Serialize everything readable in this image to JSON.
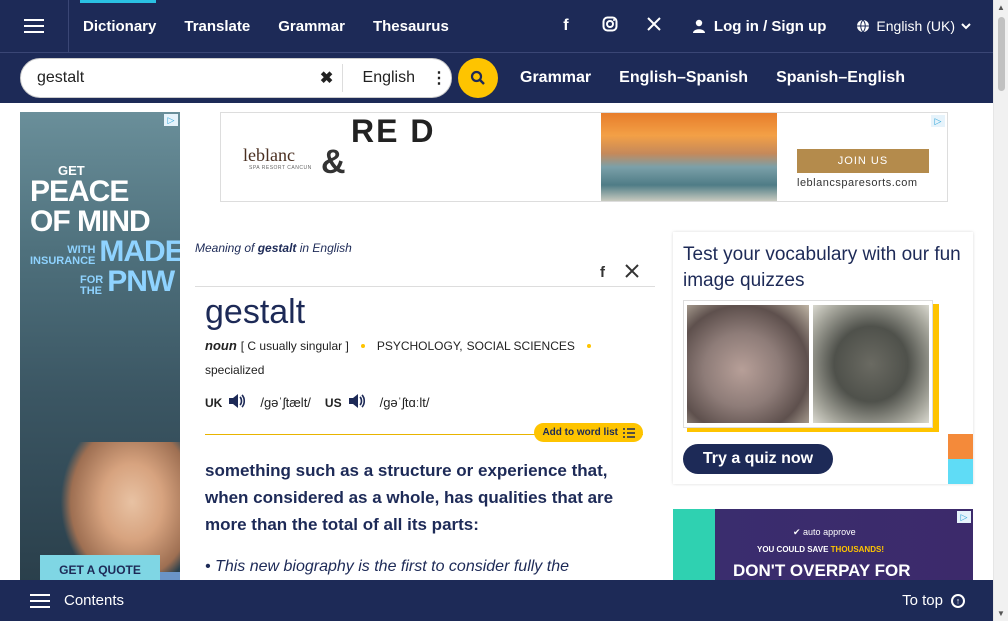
{
  "nav": {
    "links": [
      "Dictionary",
      "Translate",
      "Grammar",
      "Thesaurus"
    ],
    "login": "Log in / Sign up",
    "language": "English (UK)"
  },
  "search": {
    "value": "gestalt",
    "dictionary": "English"
  },
  "subnav": {
    "links": [
      "Grammar",
      "English–Spanish",
      "Spanish–English"
    ]
  },
  "left_ad": {
    "line1": "GET",
    "line2": "PEACE",
    "line3": "OF MIND",
    "line4": "WITH",
    "line5": "MADE",
    "line6": "INSURANCE",
    "line7": "FOR",
    "line8": "THE",
    "line9": "PNW",
    "cta": "GET A QUOTE"
  },
  "top_ad": {
    "brand": "leblanc",
    "brand_sub": "SPA RESORT CANCUN",
    "amp": "&",
    "red": "RE D",
    "join": "JOIN US",
    "url": "leblancsparesorts.com"
  },
  "entry": {
    "meaning_prefix": "Meaning of",
    "meaning_word": "gestalt",
    "meaning_suffix": "in English",
    "headword": "gestalt",
    "pos": "noun",
    "grammar": "[ C usually singular ]",
    "domains": [
      "PSYCHOLOGY,",
      "SOCIAL SCIENCES"
    ],
    "register": "specialized",
    "uk_label": "UK",
    "uk_ipa": "/ɡəˈʃtælt/",
    "us_label": "US",
    "us_ipa": "/ɡəˈʃtɑːlt/",
    "word_list": "Add to word list",
    "definition": "something such as a structure or experience that, when considered as a whole, has qualities that are more than the total of all its parts:",
    "example": "• This new biography is the first to consider fully the"
  },
  "quiz": {
    "title": "Test your vocabulary with our fun image quizzes",
    "button": "Try a quiz now"
  },
  "right_ad": {
    "brand": "auto approve",
    "save_prefix": "YOU COULD SAVE",
    "save_amount": "THOUSANDS!",
    "headline": "DON'T OVERPAY FOR"
  },
  "bottom": {
    "contents": "Contents",
    "to_top": "To top"
  }
}
